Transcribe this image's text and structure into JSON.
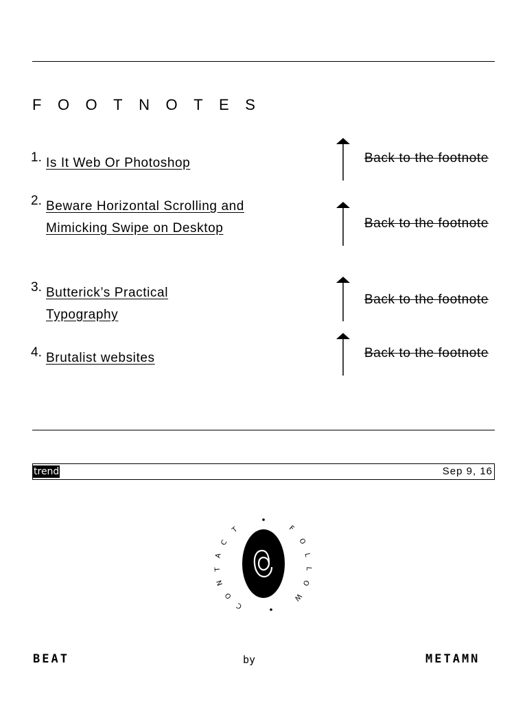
{
  "footnotes": {
    "heading": "FOOTNOTES",
    "items": [
      {
        "number": "1.",
        "title": "Is It Web Or Photoshop",
        "back_label": "Back to the footnote"
      },
      {
        "number": "2.",
        "title": "Beware Horizontal Scrolling and Mimicking Swipe on Desktop",
        "back_label": "Back to the footnote"
      },
      {
        "number": "3.",
        "title": "Butterick’s Practical Typography",
        "back_label": "Back to the footnote"
      },
      {
        "number": "4.",
        "title": "Brutalist websites",
        "back_label": "Back to the footnote"
      }
    ]
  },
  "post_meta": {
    "tag": "trend",
    "date": "Sep 9, 16"
  },
  "emblem": {
    "contact_label": "CONTACT",
    "follow_label": "FOLLOW",
    "icon": "at-sign-icon"
  },
  "footer": {
    "brand_left": "BEAT",
    "by": "by",
    "brand_right": "METAMN"
  }
}
